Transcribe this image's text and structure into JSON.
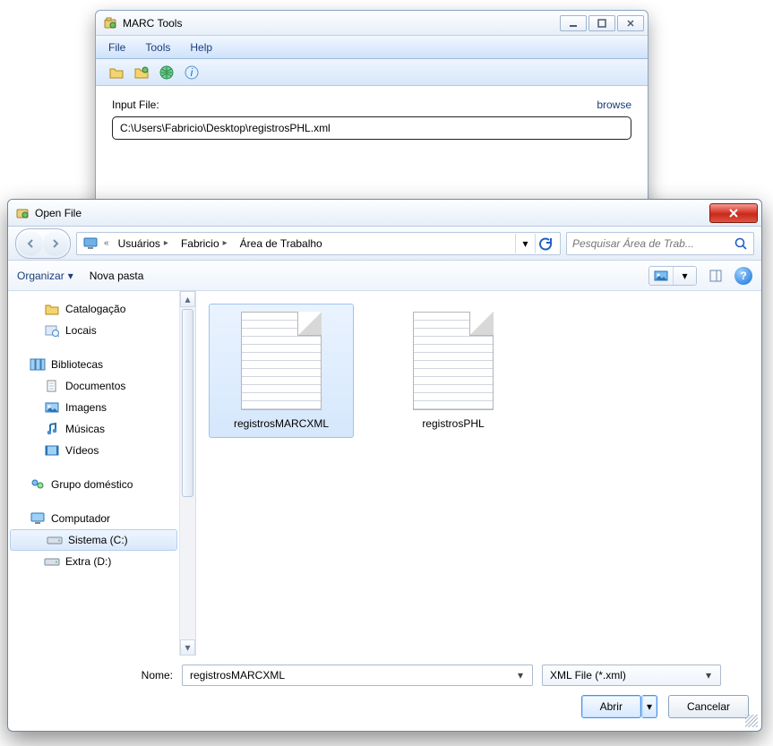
{
  "main": {
    "title": "MARC Tools",
    "menu": {
      "file": "File",
      "tools": "Tools",
      "help": "Help"
    },
    "input_label": "Input File:",
    "browse_label": "browse",
    "input_value": "C:\\Users\\Fabricio\\Desktop\\registrosPHL.xml"
  },
  "dialog": {
    "title": "Open File",
    "breadcrumb": {
      "seg1": "Usuários",
      "seg2": "Fabricio",
      "seg3": "Área de Trabalho"
    },
    "search_placeholder": "Pesquisar Área de Trab...",
    "cmd": {
      "organize": "Organizar",
      "new_folder": "Nova pasta"
    },
    "tree": {
      "catalogacao": "Catalogação",
      "locais": "Locais",
      "bibliotecas": "Bibliotecas",
      "documentos": "Documentos",
      "imagens": "Imagens",
      "musicas": "Músicas",
      "videos": "Vídeos",
      "grupo": "Grupo doméstico",
      "computador": "Computador",
      "sistema": "Sistema (C:)",
      "extra": "Extra (D:)"
    },
    "files": {
      "f1": "registrosMARCXML",
      "f2": "registrosPHL"
    },
    "bottom": {
      "name_label": "Nome:",
      "name_value": "registrosMARCXML",
      "filter_value": "XML File (*.xml)",
      "open": "Abrir",
      "cancel": "Cancelar"
    }
  }
}
